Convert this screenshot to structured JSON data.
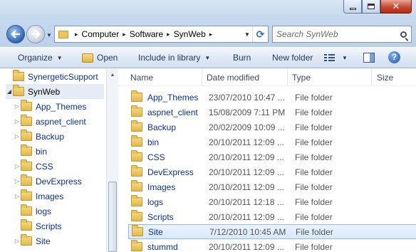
{
  "window": {
    "buttons": [
      "minimize",
      "maximize",
      "close"
    ],
    "close_glyph": "✕"
  },
  "address": {
    "crumbs": [
      "Computer",
      "Software",
      "SynWeb"
    ],
    "separator": "▸"
  },
  "search": {
    "placeholder": "Search SynWeb"
  },
  "toolbar": {
    "organize": "Organize",
    "open": "Open",
    "include_in_library": "Include in library",
    "burn": "Burn",
    "new_folder": "New folder",
    "help": "?"
  },
  "nav_tree": {
    "items": [
      {
        "label": "SynergeticSupport",
        "expander": "",
        "selected": false
      },
      {
        "label": "SynWeb",
        "expander": "◢",
        "selected": true
      },
      {
        "label": "App_Themes",
        "expander": "▷",
        "selected": false
      },
      {
        "label": "aspnet_client",
        "expander": "▷",
        "selected": false
      },
      {
        "label": "Backup",
        "expander": "▷",
        "selected": false
      },
      {
        "label": "bin",
        "expander": "",
        "selected": false
      },
      {
        "label": "CSS",
        "expander": "▷",
        "selected": false
      },
      {
        "label": "DevExpress",
        "expander": "▷",
        "selected": false
      },
      {
        "label": "Images",
        "expander": "▷",
        "selected": false
      },
      {
        "label": "logs",
        "expander": "",
        "selected": false
      },
      {
        "label": "Scripts",
        "expander": "",
        "selected": false
      },
      {
        "label": "Site",
        "expander": "▷",
        "selected": false
      }
    ]
  },
  "file_list": {
    "columns": [
      "Name",
      "Date modified",
      "Type",
      "Size"
    ],
    "rows": [
      {
        "name": "App_Themes",
        "date": "23/07/2010 10:47 ...",
        "type": "File folder",
        "selected": false
      },
      {
        "name": "aspnet_client",
        "date": "15/08/2009 7:11 PM",
        "type": "File folder",
        "selected": false
      },
      {
        "name": "Backup",
        "date": "20/02/2009 10:09 ...",
        "type": "File folder",
        "selected": false
      },
      {
        "name": "bin",
        "date": "20/10/2011 12:09 ...",
        "type": "File folder",
        "selected": false
      },
      {
        "name": "CSS",
        "date": "20/10/2011 12:09 ...",
        "type": "File folder",
        "selected": false
      },
      {
        "name": "DevExpress",
        "date": "20/10/2011 12:09 ...",
        "type": "File folder",
        "selected": false
      },
      {
        "name": "Images",
        "date": "20/10/2011 12:09 ...",
        "type": "File folder",
        "selected": false
      },
      {
        "name": "logs",
        "date": "20/10/2011 12:18 ...",
        "type": "File folder",
        "selected": false
      },
      {
        "name": "Scripts",
        "date": "20/10/2011 12:09 ...",
        "type": "File folder",
        "selected": false
      },
      {
        "name": "Site",
        "date": "7/12/2010 10:45 AM",
        "type": "File folder",
        "selected": true
      },
      {
        "name": "stummd",
        "date": "20/10/2011 12:09 ...",
        "type": "File folder",
        "selected": false
      }
    ]
  },
  "colors": {
    "link_text": "#0c2f9e",
    "selection": "#d8e9fb",
    "toolbar_text": "#1e395b"
  }
}
